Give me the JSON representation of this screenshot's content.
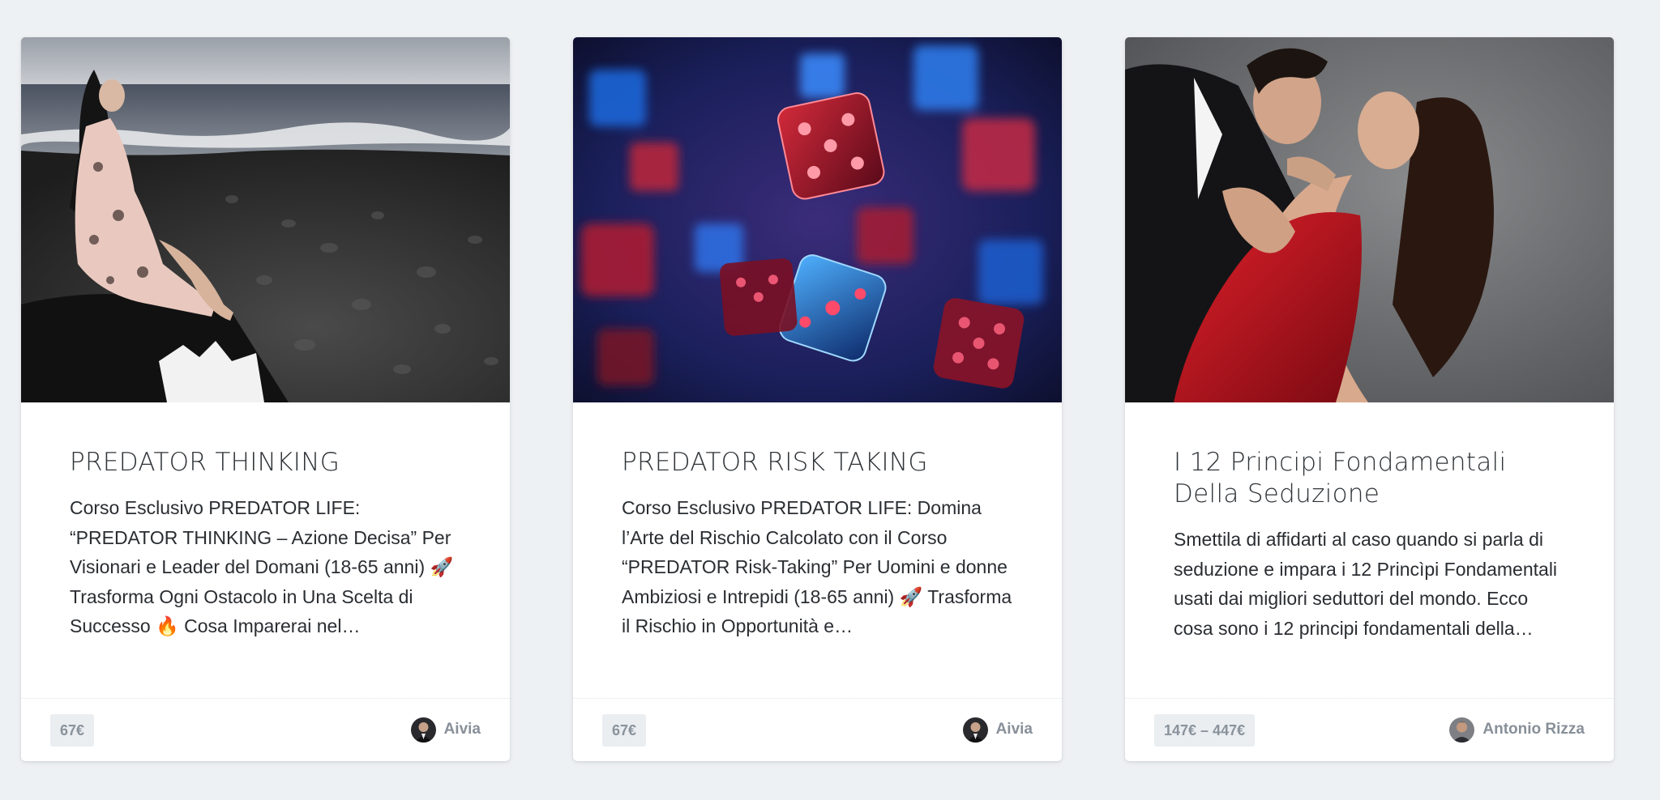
{
  "cards": [
    {
      "title": "PREDATOR THINKING",
      "description": "Corso Esclusivo PREDATOR LIFE: “PREDATOR THINKING – Azione Decisa” Per Visionari e Leader del Domani (18-65 anni) 🚀 Trasforma Ogni Ostacolo in Una Scelta di Successo 🔥 Cosa Imparerai nel…",
      "price": "67€",
      "author": "Aivia",
      "image": "woman-sitting-on-rocky-beach"
    },
    {
      "title": "PREDATOR RISK TAKING",
      "description": "Corso Esclusivo PREDATOR LIFE: Domina l’Arte del Rischio Calcolato con il Corso “PREDATOR Risk-Taking” Per Uomini e donne Ambiziosi e Intrepidi (18-65 anni) 🚀 Trasforma il Rischio in Opportunità e…",
      "price": "67€",
      "author": "Aivia",
      "image": "falling-red-and-blue-dice"
    },
    {
      "title": "I 12 Principi Fondamentali Della Seduzione",
      "description": "Smettila di affidarti al caso quando si parla di seduzione e impara i 12 Princìpi Fondamentali usati dai migliori seduttori del mondo. Ecco cosa sono i 12 principi fondamentali della…",
      "price": "147€ – 447€",
      "author": "Antonio Rizza",
      "image": "couple-embracing-red-dress"
    }
  ],
  "colors": {
    "page_background": "#eef1f4",
    "card_background": "#ffffff",
    "title_text": "#2f3337",
    "badge_background": "#eaeef1",
    "badge_text": "#8a939c",
    "author_text": "#878f98"
  }
}
